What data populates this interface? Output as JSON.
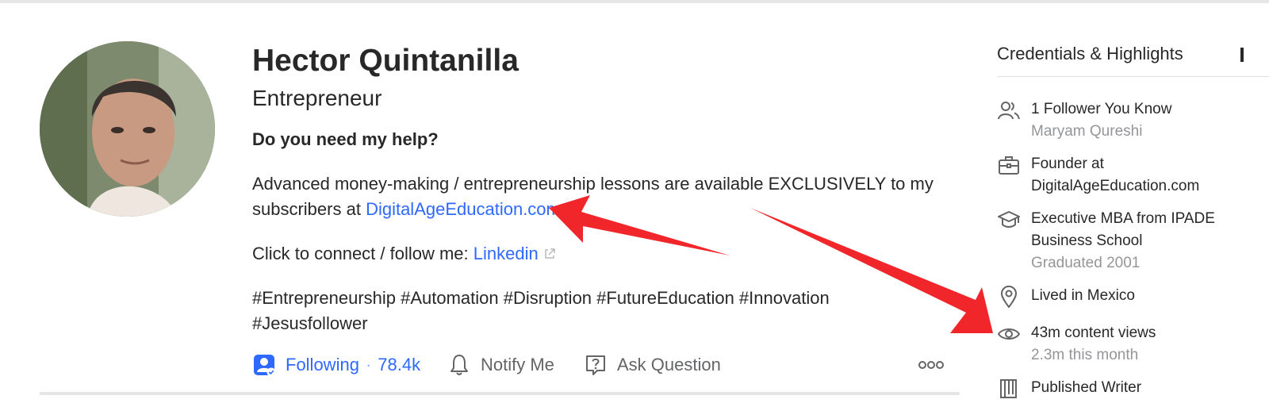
{
  "profile": {
    "name": "Hector Quintanilla",
    "tagline": "Entrepreneur",
    "bio": {
      "question": "Do you need my help?",
      "p1_text": "Advanced money-making / entrepreneurship lessons are available EXCLUSIVELY to my subscribers at ",
      "p1_link": "DigitalAgeEducation.com",
      "p2_text": "Click to connect / follow me: ",
      "p2_link": "Linkedin",
      "hashtags_line1": "#Entrepreneurship #Automation #Disruption #FutureEducation #Innovation",
      "hashtags_line2": "#Jesusfollower"
    }
  },
  "actions": {
    "following_label": "Following",
    "follower_count": "78.4k",
    "notify_label": "Notify Me",
    "ask_label": "Ask Question",
    "more_icon": "more-horizontal-icon"
  },
  "credentials": {
    "title": "Credentials & Highlights",
    "items": [
      {
        "icon": "people-icon",
        "main": "1 Follower You Know",
        "sub": "Maryam Qureshi"
      },
      {
        "icon": "briefcase-icon",
        "main": "Founder at DigitalAgeEducation.com",
        "sub": ""
      },
      {
        "icon": "graduation-cap-icon",
        "main": "Executive MBA from IPADE Business School",
        "sub": "Graduated 2001"
      },
      {
        "icon": "location-pin-icon",
        "main": "Lived in Mexico",
        "sub": ""
      },
      {
        "icon": "eye-icon",
        "main": "43m content views",
        "sub": "2.3m this month"
      },
      {
        "icon": "published-writer-icon",
        "main": "Published Writer",
        "sub": ""
      }
    ]
  },
  "colors": {
    "link": "#2e69ff",
    "annotation_arrow": "#f0262b",
    "muted_text": "#939598"
  }
}
